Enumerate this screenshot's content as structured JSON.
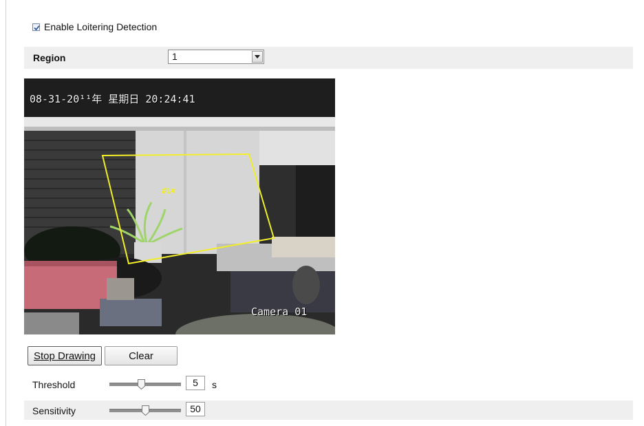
{
  "loitering": {
    "enable_label": "Enable Loitering Detection",
    "enabled": true
  },
  "region": {
    "label": "Region",
    "selected": "1"
  },
  "video": {
    "osd_time": "08-31-20¹¹年 星期日  20:24:41",
    "osd_camera": "Camera 01",
    "region_tag": "#1#",
    "polygon_color": "#f2ee2a"
  },
  "actions": {
    "stop_drawing": "Stop Drawing",
    "clear": "Clear"
  },
  "threshold": {
    "label": "Threshold",
    "value": "5",
    "unit": "s",
    "slider_fraction": 0.45
  },
  "sensitivity": {
    "label": "Sensitivity",
    "value": "50",
    "slider_fraction": 0.5
  },
  "colors": {
    "row_background": "#efefef",
    "accent": "#f2ee2a"
  }
}
